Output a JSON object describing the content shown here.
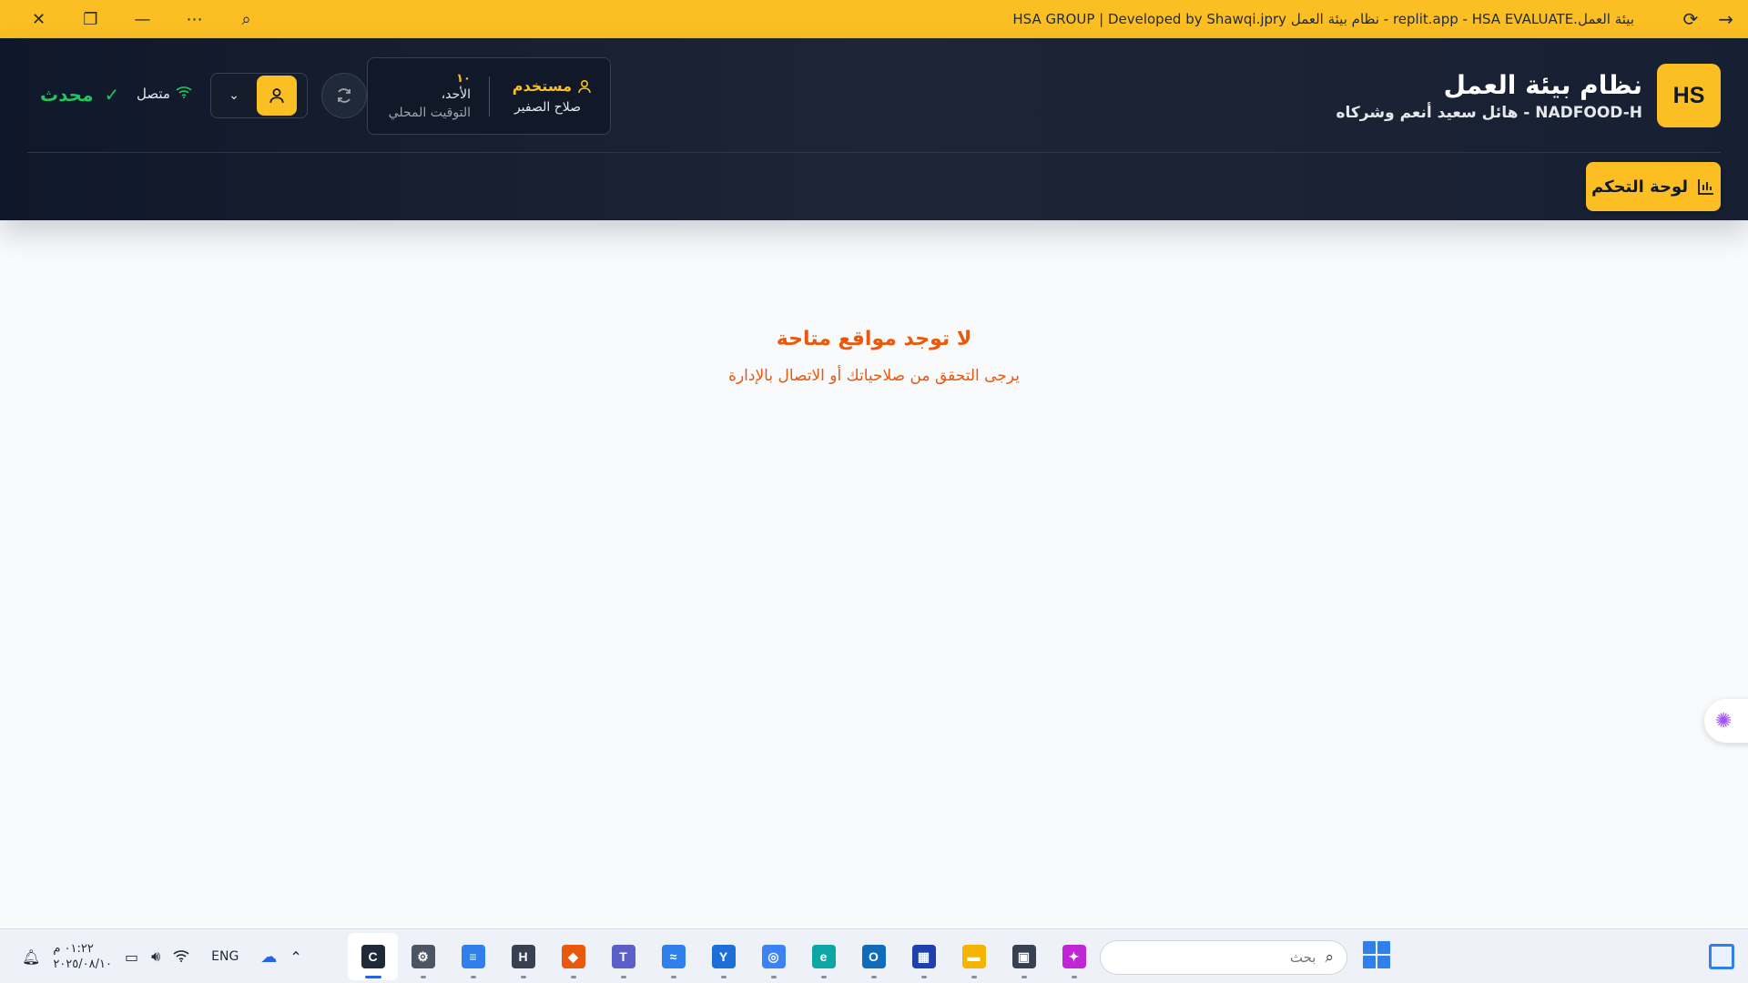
{
  "titlebar": {
    "title": "HSA GROUP | Developed by Shawqi.jpry نظام بيئة العمل - replit.app - HSA EVALUATE.بيئة العمل",
    "close_icon": "close-icon",
    "restore_icon": "restore-icon",
    "minimize_icon": "minimize-icon",
    "more_icon": "more-icon",
    "inspect_icon": "inspect-icon",
    "reload_icon": "reload-icon",
    "forward_icon": "arrow-icon"
  },
  "header": {
    "logo_text": "HS",
    "title": "نظام بيئة العمل",
    "subtitle": "NADFOOD-H - هائل سعيد أنعم وشركاه",
    "dashboard_label": "لوحة التحكم",
    "user": {
      "role": "مستخدم",
      "name": "صلاح الصفير"
    },
    "time": {
      "number": "١٠",
      "day": "الأحد،",
      "local_label": "التوقيت المحلي"
    },
    "connection_label": "متصل",
    "update_label": "محدث"
  },
  "main": {
    "empty_title": "لا توجد مواقع متاحة",
    "empty_subtitle": "يرجى التحقق من صلاحياتك أو الاتصال بالإدارة"
  },
  "taskbar": {
    "time": "٠١:٢٢ م",
    "date": "٢٠٢٥/٠٨/١٠",
    "language": "ENG",
    "search_placeholder": "بحث",
    "apps": [
      {
        "name": "c-app",
        "glyph": "C",
        "color": "#1f2937"
      },
      {
        "name": "settings",
        "glyph": "⚙",
        "color": "#4b5563"
      },
      {
        "name": "notepad",
        "glyph": "≡",
        "color": "#2f80ed"
      },
      {
        "name": "h-app",
        "glyph": "H",
        "color": "#374151"
      },
      {
        "name": "app-orange",
        "glyph": "◆",
        "color": "#ea580c"
      },
      {
        "name": "teams",
        "glyph": "T",
        "color": "#5b5fc7"
      },
      {
        "name": "scanner",
        "glyph": "≈",
        "color": "#2f80ed"
      },
      {
        "name": "yammer",
        "glyph": "Y",
        "color": "#1d6fd8"
      },
      {
        "name": "vpn",
        "glyph": "◎",
        "color": "#3b82f6"
      },
      {
        "name": "edge",
        "glyph": "e",
        "color": "#0ea5a5"
      },
      {
        "name": "outlook",
        "glyph": "O",
        "color": "#0f6cbd"
      },
      {
        "name": "store",
        "glyph": "▦",
        "color": "#1e40af"
      },
      {
        "name": "file-explorer",
        "glyph": "▬",
        "color": "#f5b400"
      },
      {
        "name": "windows-app",
        "glyph": "▣",
        "color": "#374151"
      },
      {
        "name": "copilot",
        "glyph": "✦",
        "color": "#c026d3"
      }
    ]
  }
}
